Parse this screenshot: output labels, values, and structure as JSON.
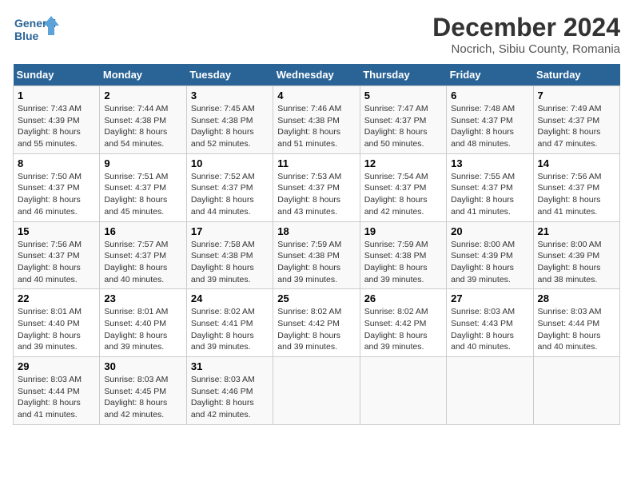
{
  "header": {
    "logo_line1": "General",
    "logo_line2": "Blue",
    "title": "December 2024",
    "subtitle": "Nocrich, Sibiu County, Romania"
  },
  "days_of_week": [
    "Sunday",
    "Monday",
    "Tuesday",
    "Wednesday",
    "Thursday",
    "Friday",
    "Saturday"
  ],
  "weeks": [
    [
      {
        "day": "1",
        "sunrise": "7:43 AM",
        "sunset": "4:39 PM",
        "daylight": "8 hours and 55 minutes."
      },
      {
        "day": "2",
        "sunrise": "7:44 AM",
        "sunset": "4:38 PM",
        "daylight": "8 hours and 54 minutes."
      },
      {
        "day": "3",
        "sunrise": "7:45 AM",
        "sunset": "4:38 PM",
        "daylight": "8 hours and 52 minutes."
      },
      {
        "day": "4",
        "sunrise": "7:46 AM",
        "sunset": "4:38 PM",
        "daylight": "8 hours and 51 minutes."
      },
      {
        "day": "5",
        "sunrise": "7:47 AM",
        "sunset": "4:37 PM",
        "daylight": "8 hours and 50 minutes."
      },
      {
        "day": "6",
        "sunrise": "7:48 AM",
        "sunset": "4:37 PM",
        "daylight": "8 hours and 48 minutes."
      },
      {
        "day": "7",
        "sunrise": "7:49 AM",
        "sunset": "4:37 PM",
        "daylight": "8 hours and 47 minutes."
      }
    ],
    [
      {
        "day": "8",
        "sunrise": "7:50 AM",
        "sunset": "4:37 PM",
        "daylight": "8 hours and 46 minutes."
      },
      {
        "day": "9",
        "sunrise": "7:51 AM",
        "sunset": "4:37 PM",
        "daylight": "8 hours and 45 minutes."
      },
      {
        "day": "10",
        "sunrise": "7:52 AM",
        "sunset": "4:37 PM",
        "daylight": "8 hours and 44 minutes."
      },
      {
        "day": "11",
        "sunrise": "7:53 AM",
        "sunset": "4:37 PM",
        "daylight": "8 hours and 43 minutes."
      },
      {
        "day": "12",
        "sunrise": "7:54 AM",
        "sunset": "4:37 PM",
        "daylight": "8 hours and 42 minutes."
      },
      {
        "day": "13",
        "sunrise": "7:55 AM",
        "sunset": "4:37 PM",
        "daylight": "8 hours and 41 minutes."
      },
      {
        "day": "14",
        "sunrise": "7:56 AM",
        "sunset": "4:37 PM",
        "daylight": "8 hours and 41 minutes."
      }
    ],
    [
      {
        "day": "15",
        "sunrise": "7:56 AM",
        "sunset": "4:37 PM",
        "daylight": "8 hours and 40 minutes."
      },
      {
        "day": "16",
        "sunrise": "7:57 AM",
        "sunset": "4:37 PM",
        "daylight": "8 hours and 40 minutes."
      },
      {
        "day": "17",
        "sunrise": "7:58 AM",
        "sunset": "4:38 PM",
        "daylight": "8 hours and 39 minutes."
      },
      {
        "day": "18",
        "sunrise": "7:59 AM",
        "sunset": "4:38 PM",
        "daylight": "8 hours and 39 minutes."
      },
      {
        "day": "19",
        "sunrise": "7:59 AM",
        "sunset": "4:38 PM",
        "daylight": "8 hours and 39 minutes."
      },
      {
        "day": "20",
        "sunrise": "8:00 AM",
        "sunset": "4:39 PM",
        "daylight": "8 hours and 39 minutes."
      },
      {
        "day": "21",
        "sunrise": "8:00 AM",
        "sunset": "4:39 PM",
        "daylight": "8 hours and 38 minutes."
      }
    ],
    [
      {
        "day": "22",
        "sunrise": "8:01 AM",
        "sunset": "4:40 PM",
        "daylight": "8 hours and 39 minutes."
      },
      {
        "day": "23",
        "sunrise": "8:01 AM",
        "sunset": "4:40 PM",
        "daylight": "8 hours and 39 minutes."
      },
      {
        "day": "24",
        "sunrise": "8:02 AM",
        "sunset": "4:41 PM",
        "daylight": "8 hours and 39 minutes."
      },
      {
        "day": "25",
        "sunrise": "8:02 AM",
        "sunset": "4:42 PM",
        "daylight": "8 hours and 39 minutes."
      },
      {
        "day": "26",
        "sunrise": "8:02 AM",
        "sunset": "4:42 PM",
        "daylight": "8 hours and 39 minutes."
      },
      {
        "day": "27",
        "sunrise": "8:03 AM",
        "sunset": "4:43 PM",
        "daylight": "8 hours and 40 minutes."
      },
      {
        "day": "28",
        "sunrise": "8:03 AM",
        "sunset": "4:44 PM",
        "daylight": "8 hours and 40 minutes."
      }
    ],
    [
      {
        "day": "29",
        "sunrise": "8:03 AM",
        "sunset": "4:44 PM",
        "daylight": "8 hours and 41 minutes."
      },
      {
        "day": "30",
        "sunrise": "8:03 AM",
        "sunset": "4:45 PM",
        "daylight": "8 hours and 42 minutes."
      },
      {
        "day": "31",
        "sunrise": "8:03 AM",
        "sunset": "4:46 PM",
        "daylight": "8 hours and 42 minutes."
      },
      null,
      null,
      null,
      null
    ]
  ]
}
